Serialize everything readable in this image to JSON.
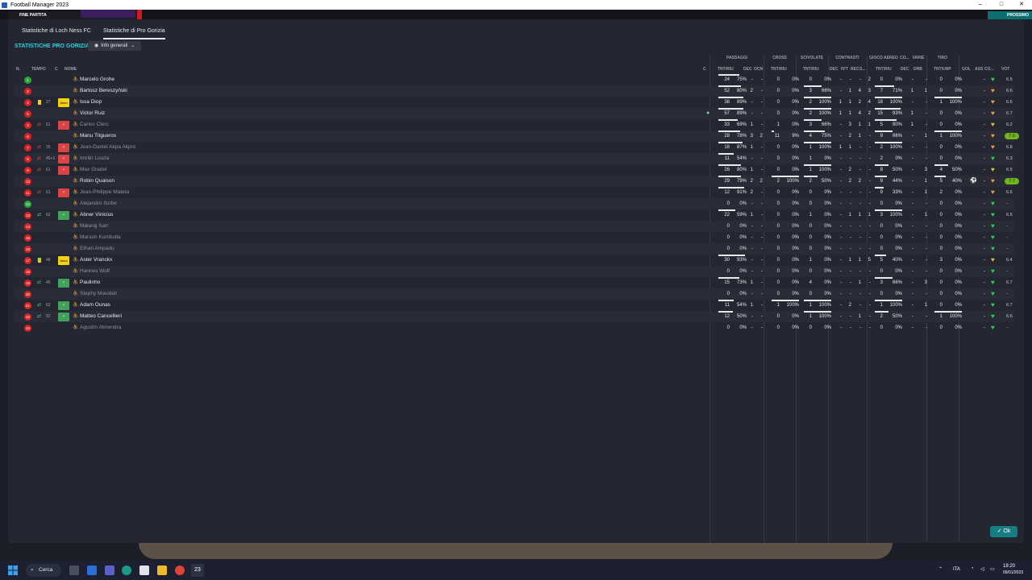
{
  "window": {
    "title": "Football Manager 2023",
    "minimize": "–",
    "maximize": "□",
    "close": "✕"
  },
  "gamebar": {
    "match_status": "FINE PARTITA",
    "right_button": "PROSSIMO"
  },
  "tabs": [
    {
      "label": "Statistiche di Loch Ness FC"
    },
    {
      "label": "Statistiche di Pro Gorizia"
    }
  ],
  "section_title": "STATISTICHE PRO GORIZIA",
  "view_select": {
    "value": "Info generali",
    "icon": "eye-icon"
  },
  "column_groups": {
    "passaggi": "PASSAGGI",
    "cross": "CROSS",
    "scivolate": "SCIVOLATE",
    "contrasti": "CONTRASTI",
    "gioco_aereo": "GIOCO AEREO",
    "co": "CO...",
    "varie": "VARIE",
    "tiro": "TIRO"
  },
  "columns": {
    "n": "N.",
    "tempo": "TEMPO",
    "c": "C",
    "nome": "NOME",
    "c2": "C",
    "pass_tntriu": "TNT/RIU",
    "pass_dec": "DEC",
    "pass_occ": "OCN",
    "cross_tntriu": "TNT/RIU",
    "sciv_tntriu": "TNT/RIU",
    "contr_dec": "DEC",
    "contr_fft": "FFT",
    "contr_rec": "REC",
    "contr_s": "S...",
    "aereo_tntriu": "TNT/RIU",
    "co_dec": "DEC",
    "varie_drb": "DRB",
    "tiro_tntunp": "TNT/UNP",
    "gol": "GOL",
    "ass": "ASS",
    "co": "CO...",
    "vot": "VOT"
  },
  "players": [
    {
      "num": "1",
      "numc": "green",
      "yc": false,
      "sub": "",
      "min": "",
      "badge": "",
      "name": "Marcelo Grohe",
      "active": true,
      "ball": "",
      "pass": [
        "24",
        "75%"
      ],
      "pdec": "-",
      "pocc": "-",
      "cross": [
        "0",
        "0%"
      ],
      "sciv": [
        "0",
        "0%"
      ],
      "cdec": "-",
      "cfft": "-",
      "crec": "-",
      "cs": "2",
      "aereo": [
        "0",
        "0%"
      ],
      "codec": "-",
      "drb": "-",
      "tiro": [
        "0",
        "0%"
      ],
      "gol": "",
      "ass": "-",
      "heart": "#2fd15a",
      "vot": "6.5",
      "votbox": false
    },
    {
      "num": "2",
      "numc": "red",
      "yc": false,
      "sub": "",
      "min": "",
      "badge": "",
      "name": "Bartosz Bereszyński",
      "active": true,
      "ball": "",
      "pass": [
        "52",
        "80%"
      ],
      "pdec": "2",
      "pocc": "-",
      "cross": [
        "0",
        "0%"
      ],
      "sciv": [
        "3",
        "66%"
      ],
      "cdec": "-",
      "cfft": "1",
      "crec": "4",
      "cs": "3",
      "aereo": [
        "7",
        "71%"
      ],
      "codec": "1",
      "drb": "1",
      "tiro": [
        "0",
        "0%"
      ],
      "gol": "",
      "ass": "-",
      "heart": "#e8a04a",
      "vot": "6.6",
      "votbox": false
    },
    {
      "num": "4",
      "numc": "red",
      "yc": true,
      "sub": "",
      "min": "27",
      "badge": "Amm",
      "name": "Issa Diop",
      "active": true,
      "ball": "",
      "pass": [
        "38",
        "89%"
      ],
      "pdec": "-",
      "pocc": "-",
      "cross": [
        "0",
        "0%"
      ],
      "sciv": [
        "2",
        "100%"
      ],
      "cdec": "1",
      "cfft": "1",
      "crec": "2",
      "cs": "4",
      "aereo": [
        "18",
        "100%"
      ],
      "codec": "-",
      "drb": "-",
      "tiro": [
        "1",
        "100%"
      ],
      "gol": "",
      "ass": "-",
      "heart": "#e8a04a",
      "vot": "6.6",
      "votbox": false
    },
    {
      "num": "5",
      "numc": "red",
      "yc": false,
      "sub": "",
      "min": "",
      "badge": "",
      "name": "Victor Ruiz",
      "active": true,
      "ball": "⚽",
      "pass": [
        "57",
        "89%"
      ],
      "pdec": "-",
      "pocc": "-",
      "cross": [
        "0",
        "0%"
      ],
      "sciv": [
        "2",
        "100%"
      ],
      "cdec": "1",
      "cfft": "1",
      "crec": "4",
      "cs": "2",
      "aereo": [
        "15",
        "93%"
      ],
      "codec": "1",
      "drb": "-",
      "tiro": [
        "0",
        "0%"
      ],
      "gol": "",
      "ass": "-",
      "heart": "#e8a04a",
      "vot": "6.7",
      "votbox": false
    },
    {
      "num": "3",
      "numc": "red",
      "yc": false,
      "sub": "out",
      "min": "61",
      "badge": "out",
      "name": "Carlos Clerc",
      "active": false,
      "ball": "",
      "pass": [
        "33",
        "69%"
      ],
      "pdec": "1",
      "pocc": "-",
      "cross": [
        "1",
        "0%"
      ],
      "sciv": [
        "3",
        "66%"
      ],
      "cdec": "-",
      "cfft": "3",
      "crec": "1",
      "cs": "1",
      "aereo": [
        "5",
        "80%"
      ],
      "codec": "1",
      "drb": "-",
      "tiro": [
        "0",
        "0%"
      ],
      "gol": "",
      "ass": "-",
      "heart": "#d8c64a",
      "vot": "6.2",
      "votbox": false
    },
    {
      "num": "6",
      "numc": "red",
      "yc": false,
      "sub": "",
      "min": "",
      "badge": "",
      "name": "Manu Trigueros",
      "active": true,
      "ball": "",
      "pass": [
        "28",
        "78%"
      ],
      "pdec": "3",
      "pocc": "2",
      "cross": [
        "11",
        "9%"
      ],
      "sciv": [
        "4",
        "75%"
      ],
      "cdec": "-",
      "cfft": "2",
      "crec": "1",
      "cs": "-",
      "aereo": [
        "9",
        "66%"
      ],
      "codec": "-",
      "drb": "1",
      "tiro": [
        "1",
        "100%"
      ],
      "gol": "",
      "ass": "-",
      "heart": "#e8a04a",
      "vot": "7.0",
      "votbox": true
    },
    {
      "num": "7",
      "numc": "red",
      "yc": false,
      "sub": "out",
      "min": "25",
      "badge": "out",
      "name": "Jean-Daniel Akpa Akpro",
      "active": false,
      "ball": "",
      "pass": [
        "16",
        "87%"
      ],
      "pdec": "1",
      "pocc": "-",
      "cross": [
        "0",
        "0%"
      ],
      "sciv": [
        "1",
        "100%"
      ],
      "cdec": "1",
      "cfft": "1",
      "crec": "-",
      "cs": "-",
      "aereo": [
        "2",
        "100%"
      ],
      "codec": "-",
      "drb": "-",
      "tiro": [
        "0",
        "0%"
      ],
      "gol": "",
      "ass": "-",
      "heart": "#e8a04a",
      "vot": "6.8",
      "votbox": false
    },
    {
      "num": "8",
      "numc": "red",
      "yc": false,
      "sub": "out",
      "min": "45+1",
      "badge": "out",
      "name": "Imrân Louza",
      "active": false,
      "ball": "",
      "pass": [
        "11",
        "54%"
      ],
      "pdec": "-",
      "pocc": "-",
      "cross": [
        "0",
        "0%"
      ],
      "sciv": [
        "1",
        "0%"
      ],
      "cdec": "-",
      "cfft": "-",
      "crec": "-",
      "cs": "-",
      "aereo": [
        "2",
        "0%"
      ],
      "codec": "-",
      "drb": "-",
      "tiro": [
        "0",
        "0%"
      ],
      "gol": "",
      "ass": "-",
      "heart": "#2fd15a",
      "vot": "6.3",
      "votbox": false
    },
    {
      "num": "9",
      "numc": "red",
      "yc": false,
      "sub": "out",
      "min": "61",
      "badge": "out",
      "name": "Max Gradel",
      "active": false,
      "ball": "",
      "pass": [
        "26",
        "80%"
      ],
      "pdec": "1",
      "pocc": "-",
      "cross": [
        "0",
        "0%"
      ],
      "sciv": [
        "1",
        "100%"
      ],
      "cdec": "-",
      "cfft": "2",
      "crec": "-",
      "cs": "-",
      "aereo": [
        "8",
        "50%"
      ],
      "codec": "-",
      "drb": "3",
      "tiro": [
        "4",
        "50%"
      ],
      "gol": "",
      "ass": "-",
      "heart": "#d8c64a",
      "vot": "6.5",
      "votbox": false
    },
    {
      "num": "10",
      "numc": "red",
      "yc": false,
      "sub": "",
      "min": "",
      "badge": "",
      "name": "Robin Quaison",
      "active": true,
      "ball": "",
      "pass": [
        "29",
        "79%"
      ],
      "pdec": "2",
      "pocc": "2",
      "cross": [
        "2",
        "100%"
      ],
      "sciv": [
        "2",
        "50%"
      ],
      "cdec": "-",
      "cfft": "2",
      "crec": "2",
      "cs": "-",
      "aereo": [
        "9",
        "44%"
      ],
      "codec": "-",
      "drb": "1",
      "tiro": [
        "5",
        "40%"
      ],
      "gol": "⚽",
      "ass": "-",
      "heart": "#e8a04a",
      "vot": "7.7",
      "votbox": true
    },
    {
      "num": "11",
      "numc": "red",
      "yc": false,
      "sub": "out",
      "min": "61",
      "badge": "out",
      "name": "Jean-Philippe Mateta",
      "active": false,
      "ball": "",
      "pass": [
        "12",
        "91%"
      ],
      "pdec": "2",
      "pocc": "-",
      "cross": [
        "0",
        "0%"
      ],
      "sciv": [
        "0",
        "0%"
      ],
      "cdec": "-",
      "cfft": "-",
      "crec": "-",
      "cs": "-",
      "aereo": [
        "9",
        "33%"
      ],
      "codec": "-",
      "drb": "1",
      "tiro": [
        "2",
        "0%"
      ],
      "gol": "",
      "ass": "-",
      "heart": "#e8a04a",
      "vot": "6.6",
      "votbox": false
    },
    {
      "num": "12",
      "numc": "green",
      "yc": false,
      "sub": "",
      "min": "",
      "badge": "",
      "name": "Alejandro Iturbe",
      "active": false,
      "ball": "",
      "pass": [
        "0",
        "0%"
      ],
      "pdec": "-",
      "pocc": "-",
      "cross": [
        "0",
        "0%"
      ],
      "sciv": [
        "0",
        "0%"
      ],
      "cdec": "-",
      "cfft": "-",
      "crec": "-",
      "cs": "-",
      "aereo": [
        "0",
        "0%"
      ],
      "codec": "-",
      "drb": "-",
      "tiro": [
        "0",
        "0%"
      ],
      "gol": "",
      "ass": "-",
      "heart": "#2fd15a",
      "vot": "-",
      "votbox": false
    },
    {
      "num": "13",
      "numc": "red",
      "yc": false,
      "sub": "in",
      "min": "62",
      "badge": "in",
      "name": "Abner Vinicius",
      "active": true,
      "ball": "",
      "pass": [
        "22",
        "59%"
      ],
      "pdec": "1",
      "pocc": "-",
      "cross": [
        "0",
        "0%"
      ],
      "sciv": [
        "1",
        "0%"
      ],
      "cdec": "-",
      "cfft": "1",
      "crec": "1",
      "cs": "1",
      "aereo": [
        "3",
        "100%"
      ],
      "codec": "-",
      "drb": "1",
      "tiro": [
        "0",
        "0%"
      ],
      "gol": "",
      "ass": "-",
      "heart": "#2fd15a",
      "vot": "6.5",
      "votbox": false
    },
    {
      "num": "14",
      "numc": "red",
      "yc": false,
      "sub": "",
      "min": "",
      "badge": "",
      "name": "Malang Sarr",
      "active": false,
      "ball": "",
      "pass": [
        "0",
        "0%"
      ],
      "pdec": "-",
      "pocc": "-",
      "cross": [
        "0",
        "0%"
      ],
      "sciv": [
        "0",
        "0%"
      ],
      "cdec": "-",
      "cfft": "-",
      "crec": "-",
      "cs": "-",
      "aereo": [
        "0",
        "0%"
      ],
      "codec": "-",
      "drb": "-",
      "tiro": [
        "0",
        "0%"
      ],
      "gol": "",
      "ass": "-",
      "heart": "#2fd15a",
      "vot": "-",
      "votbox": false
    },
    {
      "num": "15",
      "numc": "red",
      "yc": false,
      "sub": "",
      "min": "",
      "badge": "",
      "name": "Marash Kumbulla",
      "active": false,
      "ball": "",
      "pass": [
        "0",
        "0%"
      ],
      "pdec": "-",
      "pocc": "-",
      "cross": [
        "0",
        "0%"
      ],
      "sciv": [
        "0",
        "0%"
      ],
      "cdec": "-",
      "cfft": "-",
      "crec": "-",
      "cs": "-",
      "aereo": [
        "0",
        "0%"
      ],
      "codec": "-",
      "drb": "-",
      "tiro": [
        "0",
        "0%"
      ],
      "gol": "",
      "ass": "-",
      "heart": "#2fd15a",
      "vot": "-",
      "votbox": false
    },
    {
      "num": "16",
      "numc": "red",
      "yc": false,
      "sub": "",
      "min": "",
      "badge": "",
      "name": "Ethan Ampadu",
      "active": false,
      "ball": "",
      "pass": [
        "0",
        "0%"
      ],
      "pdec": "-",
      "pocc": "-",
      "cross": [
        "0",
        "0%"
      ],
      "sciv": [
        "0",
        "0%"
      ],
      "cdec": "-",
      "cfft": "-",
      "crec": "-",
      "cs": "-",
      "aereo": [
        "0",
        "0%"
      ],
      "codec": "-",
      "drb": "-",
      "tiro": [
        "0",
        "0%"
      ],
      "gol": "",
      "ass": "-",
      "heart": "#2fd15a",
      "vot": "-",
      "votbox": false
    },
    {
      "num": "17",
      "numc": "red",
      "yc": true,
      "sub": "in",
      "min": "48",
      "badge": "Amm",
      "name": "Aster Vranckx",
      "active": true,
      "ball": "",
      "pass": [
        "30",
        "93%"
      ],
      "pdec": "-",
      "pocc": "-",
      "cross": [
        "0",
        "0%"
      ],
      "sciv": [
        "1",
        "0%"
      ],
      "cdec": "-",
      "cfft": "1",
      "crec": "1",
      "cs": "5",
      "aereo": [
        "5",
        "40%"
      ],
      "codec": "-",
      "drb": "-",
      "tiro": [
        "3",
        "0%"
      ],
      "gol": "",
      "ass": "-",
      "heart": "#d8c64a",
      "vot": "6.4",
      "votbox": false
    },
    {
      "num": "18",
      "numc": "red",
      "yc": false,
      "sub": "",
      "min": "",
      "badge": "",
      "name": "Hannes Wolf",
      "active": false,
      "ball": "",
      "pass": [
        "0",
        "0%"
      ],
      "pdec": "-",
      "pocc": "-",
      "cross": [
        "0",
        "0%"
      ],
      "sciv": [
        "0",
        "0%"
      ],
      "cdec": "-",
      "cfft": "-",
      "crec": "-",
      "cs": "-",
      "aereo": [
        "0",
        "0%"
      ],
      "codec": "-",
      "drb": "-",
      "tiro": [
        "0",
        "0%"
      ],
      "gol": "",
      "ass": "-",
      "heart": "#2fd15a",
      "vot": "-",
      "votbox": false
    },
    {
      "num": "19",
      "numc": "red",
      "yc": false,
      "sub": "in",
      "min": "45",
      "badge": "in",
      "name": "Paulinho",
      "active": true,
      "ball": "",
      "pass": [
        "15",
        "73%"
      ],
      "pdec": "1",
      "pocc": "-",
      "cross": [
        "0",
        "0%"
      ],
      "sciv": [
        "4",
        "0%"
      ],
      "cdec": "-",
      "cfft": "-",
      "crec": "1",
      "cs": "-",
      "aereo": [
        "3",
        "66%"
      ],
      "codec": "-",
      "drb": "3",
      "tiro": [
        "0",
        "0%"
      ],
      "gol": "",
      "ass": "-",
      "heart": "#2fd15a",
      "vot": "6.7",
      "votbox": false
    },
    {
      "num": "20",
      "numc": "red",
      "yc": false,
      "sub": "",
      "min": "",
      "badge": "",
      "name": "Stephy Mavididi",
      "active": false,
      "ball": "",
      "pass": [
        "0",
        "0%"
      ],
      "pdec": "-",
      "pocc": "-",
      "cross": [
        "0",
        "0%"
      ],
      "sciv": [
        "0",
        "0%"
      ],
      "cdec": "-",
      "cfft": "-",
      "crec": "-",
      "cs": "-",
      "aereo": [
        "0",
        "0%"
      ],
      "codec": "-",
      "drb": "-",
      "tiro": [
        "0",
        "0%"
      ],
      "gol": "",
      "ass": "-",
      "heart": "#2fd15a",
      "vot": "-",
      "votbox": false
    },
    {
      "num": "21",
      "numc": "red",
      "yc": false,
      "sub": "in",
      "min": "62",
      "badge": "in",
      "name": "Adam Ounas",
      "active": true,
      "ball": "",
      "pass": [
        "11",
        "54%"
      ],
      "pdec": "1",
      "pocc": "-",
      "cross": [
        "1",
        "100%"
      ],
      "sciv": [
        "1",
        "100%"
      ],
      "cdec": "-",
      "cfft": "2",
      "crec": "-",
      "cs": "-",
      "aereo": [
        "1",
        "100%"
      ],
      "codec": "-",
      "drb": "1",
      "tiro": [
        "0",
        "0%"
      ],
      "gol": "",
      "ass": "-",
      "heart": "#2fd15a",
      "vot": "6.7",
      "votbox": false
    },
    {
      "num": "22",
      "numc": "red",
      "yc": false,
      "sub": "in",
      "min": "62",
      "badge": "in",
      "name": "Matteo Cancellieri",
      "active": true,
      "ball": "",
      "pass": [
        "12",
        "50%"
      ],
      "pdec": "-",
      "pocc": "-",
      "cross": [
        "0",
        "0%"
      ],
      "sciv": [
        "1",
        "100%"
      ],
      "cdec": "-",
      "cfft": "-",
      "crec": "1",
      "cs": "-",
      "aereo": [
        "2",
        "50%"
      ],
      "codec": "-",
      "drb": "-",
      "tiro": [
        "1",
        "100%"
      ],
      "gol": "",
      "ass": "-",
      "heart": "#2fd15a",
      "vot": "6.6",
      "votbox": false
    },
    {
      "num": "23",
      "numc": "red",
      "yc": false,
      "sub": "",
      "min": "",
      "badge": "",
      "name": "Agustín Almendra",
      "active": false,
      "ball": "",
      "pass": [
        "0",
        "0%"
      ],
      "pdec": "-",
      "pocc": "-",
      "cross": [
        "0",
        "0%"
      ],
      "sciv": [
        "0",
        "0%"
      ],
      "cdec": "-",
      "cfft": "-",
      "crec": "-",
      "cs": "-",
      "aereo": [
        "0",
        "0%"
      ],
      "codec": "-",
      "drb": "-",
      "tiro": [
        "0",
        "0%"
      ],
      "gol": "",
      "ass": "-",
      "heart": "#2fd15a",
      "vot": "-",
      "votbox": false
    }
  ],
  "ok_button": {
    "label": "Ok",
    "icon": "check-icon"
  },
  "taskbar": {
    "search_label": "Cerca",
    "lang": "ITA",
    "time": "18:20",
    "date": "09/01/2023",
    "fm_label": "23"
  }
}
